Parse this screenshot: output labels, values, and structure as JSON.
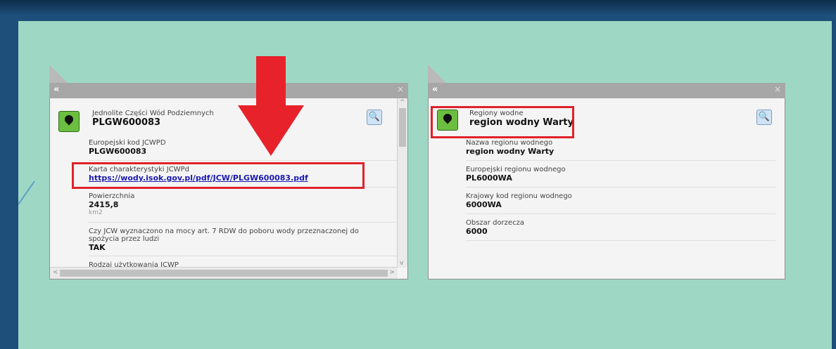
{
  "popup_left": {
    "collapse_label": "«",
    "close_label": "×",
    "layer_name": "Jednolite Części Wód Podziemnych",
    "feature_id": "PLGW600083",
    "fields": [
      {
        "label": "Europejski kod JCWPD",
        "value": "PLGW600083"
      },
      {
        "label": "Karta charakterystyki JCWPd",
        "value": "https://wody.isok.gov.pl/pdf/JCW/PLGW600083.pdf"
      },
      {
        "label": "Powierzchnia",
        "value": "2415,8",
        "unit": "km2"
      },
      {
        "label": "Czy JCW wyznaczono na mocy art. 7 RDW do poboru wody przeznaczonej do",
        "label2": "spożycia przez ludzi",
        "value": "TAK"
      },
      {
        "label": "Rodzaj użytkowania JCWP"
      }
    ],
    "zoom_icon": "magnifier-icon",
    "scroll_arrows": {
      "up": "^",
      "down": "v",
      "left": "<",
      "right": ">"
    }
  },
  "popup_right": {
    "collapse_label": "«",
    "close_label": "×",
    "layer_name": "Regiony wodne",
    "feature_id": "region wodny Warty",
    "fields": [
      {
        "label": "Nazwa regionu wodnego",
        "value": "region wodny Warty"
      },
      {
        "label": "Europejski regionu wodnego",
        "value": "PL6000WA"
      },
      {
        "label": "Krajowy kod regionu wodnego",
        "value": "6000WA"
      },
      {
        "label": "Obszar dorzecza",
        "value": "6000"
      }
    ],
    "zoom_icon": "magnifier-icon"
  },
  "colors": {
    "map_bg": "#9ed8c4",
    "highlight": "#e0222a",
    "marker": "#6bbe3f"
  }
}
